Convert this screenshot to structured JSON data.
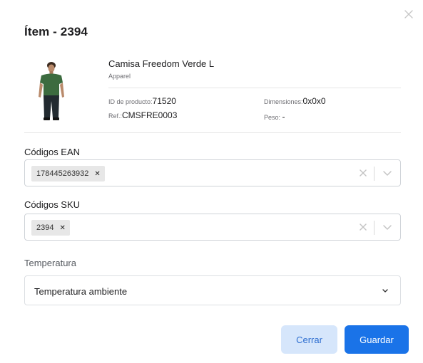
{
  "modal": {
    "title": "Ítem - 2394"
  },
  "icons": {
    "close": "close-icon",
    "clear": "clear-icon",
    "chevron": "chevron-down-icon",
    "chip_remove": "remove-chip-icon"
  },
  "product": {
    "name": "Camisa Freedom Verde L",
    "category": "Apparel",
    "id_label": "ID de producto:",
    "id_value": "71520",
    "ref_label": "Ref.:",
    "ref_value": "CMSFRE0003",
    "dim_label": "Dimensiones:",
    "dim_value": "0x0x0",
    "peso_label": "Peso:",
    "peso_value": "-"
  },
  "ean": {
    "label": "Códigos EAN",
    "chips": [
      "178445263932"
    ]
  },
  "sku": {
    "label": "Códigos SKU",
    "chips": [
      "2394"
    ]
  },
  "temperature": {
    "label": "Temperatura",
    "selected": "Temperatura ambiente"
  },
  "actions": {
    "close_label": "Cerrar",
    "save_label": "Guardar"
  },
  "colors": {
    "primary": "#1a73e8",
    "secondary_bg": "#d6e6fb",
    "secondary_text": "#2f6fd0"
  }
}
